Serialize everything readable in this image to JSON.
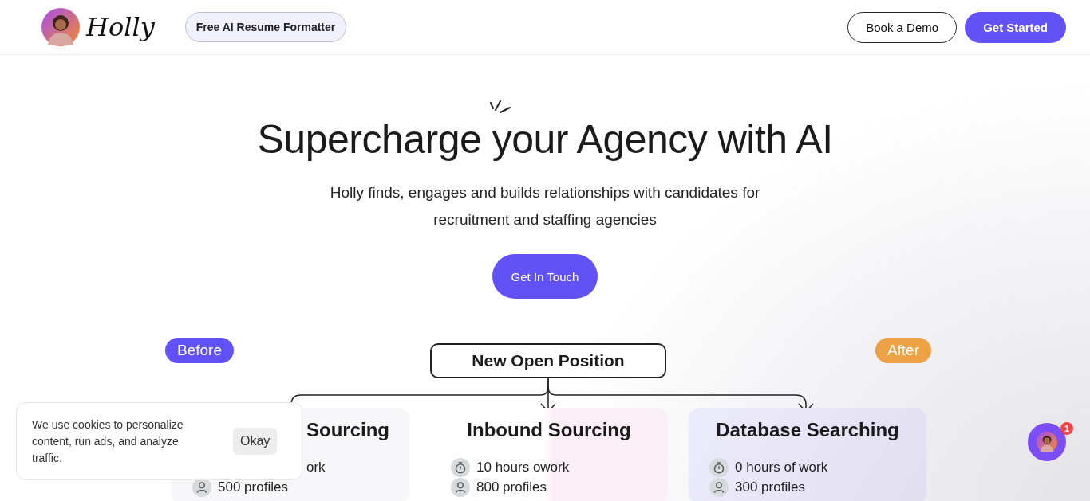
{
  "header": {
    "logo_text": "Holly",
    "nav_pill": "Free AI Resume Formatter",
    "buttons": [
      {
        "label": "Book a Demo",
        "kind": "outline"
      },
      {
        "label": "Get Started",
        "kind": "primary"
      }
    ]
  },
  "hero": {
    "title": "Supercharge your Agency with AI",
    "subtitle": "Holly finds, engages and builds relationships with candidates for recruitment and staffing agencies",
    "cta": "Get In Touch"
  },
  "diagram": {
    "before_label": "Before",
    "after_label": "After",
    "root": "New Open Position",
    "cards": [
      {
        "title": "Sourcing",
        "stats": [
          {
            "kind": "text",
            "text": "ork"
          },
          {
            "kind": "profiles",
            "text": "500 profiles"
          }
        ]
      },
      {
        "title": "Inbound Sourcing",
        "stats": [
          {
            "kind": "time",
            "text": "10 hours owork"
          },
          {
            "kind": "profiles",
            "text": "800 profiles"
          }
        ]
      },
      {
        "title": "Database Searching",
        "stats": [
          {
            "kind": "time",
            "text": "0 hours of work"
          },
          {
            "kind": "profiles",
            "text": "300 profiles"
          }
        ]
      }
    ]
  },
  "cookie": {
    "text": "We use cookies to personalize content, run ads, and analyze traffic.",
    "button": "Okay"
  },
  "chat": {
    "badge": "1"
  }
}
